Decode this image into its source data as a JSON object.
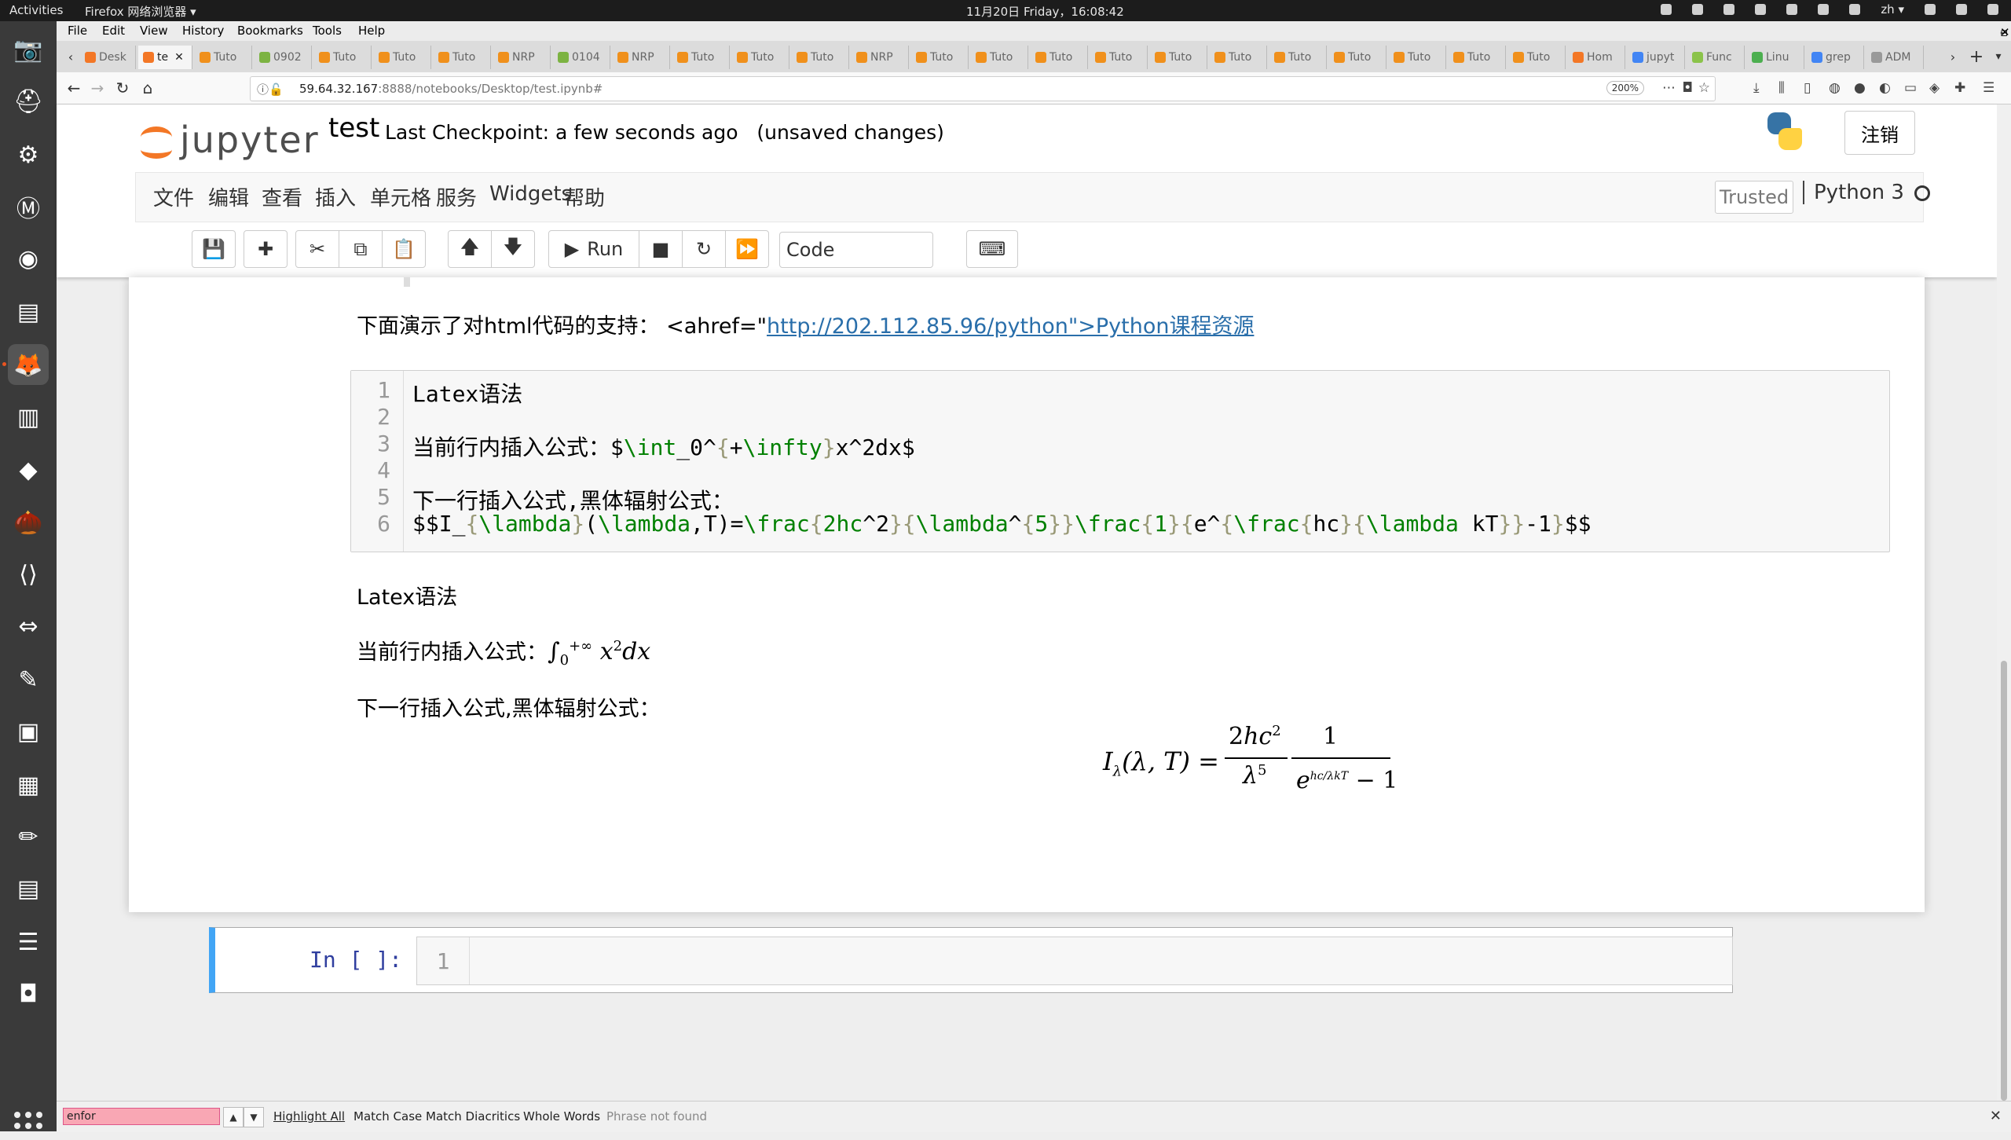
{
  "topbar": {
    "activities": "Activities",
    "app_menu": "Firefox 网络浏览器 ▾",
    "clock": "11月20日 Friday，16:08:42",
    "lang": "zh ▾"
  },
  "menubar": {
    "items": [
      "File",
      "Edit",
      "View",
      "History",
      "Bookmarks",
      "Tools",
      "Help"
    ]
  },
  "tabs": [
    {
      "label": "Desk",
      "color": "#f37726"
    },
    {
      "label": "te",
      "color": "#f37726"
    },
    {
      "label": "Tuto",
      "color": "#f0901c"
    },
    {
      "label": "0902",
      "color": "#7cb342"
    },
    {
      "label": "Tuto",
      "color": "#f0901c"
    },
    {
      "label": "Tuto",
      "color": "#f0901c"
    },
    {
      "label": "Tuto",
      "color": "#f0901c"
    },
    {
      "label": "NRP",
      "color": "#f0901c"
    },
    {
      "label": "0104",
      "color": "#7cb342"
    },
    {
      "label": "NRP",
      "color": "#f0901c"
    },
    {
      "label": "Tuto",
      "color": "#f0901c"
    },
    {
      "label": "Tuto",
      "color": "#f0901c"
    },
    {
      "label": "Tuto",
      "color": "#f0901c"
    },
    {
      "label": "NRP",
      "color": "#f0901c"
    },
    {
      "label": "Tuto",
      "color": "#f0901c"
    },
    {
      "label": "Tuto",
      "color": "#f0901c"
    },
    {
      "label": "Tuto",
      "color": "#f0901c"
    },
    {
      "label": "Tuto",
      "color": "#f0901c"
    },
    {
      "label": "Tuto",
      "color": "#f0901c"
    },
    {
      "label": "Tuto",
      "color": "#f0901c"
    },
    {
      "label": "Tuto",
      "color": "#f0901c"
    },
    {
      "label": "Tuto",
      "color": "#f0901c"
    },
    {
      "label": "Tuto",
      "color": "#f0901c"
    },
    {
      "label": "Tuto",
      "color": "#f0901c"
    },
    {
      "label": "Tuto",
      "color": "#f0901c"
    },
    {
      "label": "Hom",
      "color": "#f37726"
    },
    {
      "label": "jupyt",
      "color": "#4285f4"
    },
    {
      "label": "Func",
      "color": "#8bc34a"
    },
    {
      "label": "Linu",
      "color": "#4caf50"
    },
    {
      "label": "grep",
      "color": "#4285f4"
    },
    {
      "label": "ADM",
      "color": "#999999"
    }
  ],
  "url": {
    "host": "59.64.32.167",
    "path": ":8888/notebooks/Desktop/test.ipynb#",
    "zoom": "200%"
  },
  "jupyter": {
    "logo_text": "jupyter",
    "notebook_name": "test",
    "checkpoint": "Last Checkpoint: a few seconds ago   (unsaved changes)",
    "logout": "注销",
    "menu": [
      "文件",
      "编辑",
      "查看",
      "插入",
      "单元格",
      "服务",
      "Widgets",
      "帮助"
    ],
    "trusted": "Trusted",
    "kernel": "Python 3",
    "run_label": "Run",
    "cell_type": "Code"
  },
  "cells": {
    "html_text": "下面演示了对html代码的支持：  <ahref=\"",
    "html_link": "http://202.112.85.96/python\">Python课程资源",
    "code_line_numbers": [
      "1",
      "2",
      "3",
      "4",
      "5",
      "6"
    ],
    "md_title": "Latex语法",
    "md_inline_label": "当前行内插入公式：",
    "md_next_label": "下一行插入公式,黑体辐射公式：",
    "input_prompt": "In [ ]:",
    "input_line": "1"
  },
  "findbar": {
    "value": "enfor",
    "highlight_all": "Highlight All",
    "match_case": "Match Case",
    "match_diacritics": "Match Diacritics",
    "whole_words": "Whole Words",
    "status": "Phrase not found"
  }
}
